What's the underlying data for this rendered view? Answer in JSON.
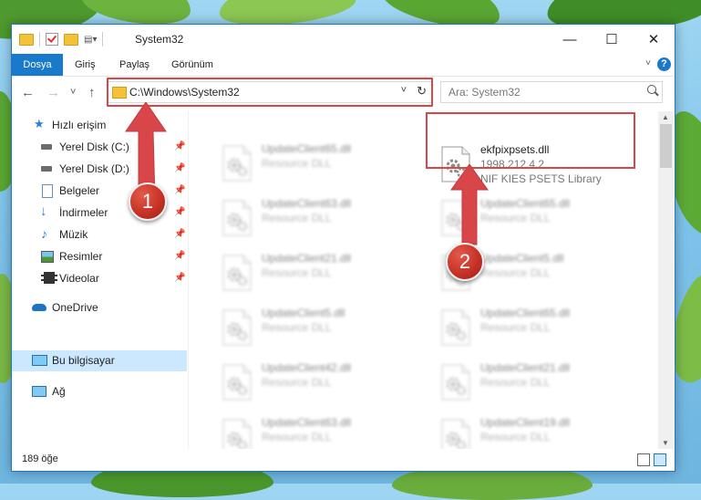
{
  "window": {
    "title": "System32",
    "controls": {
      "minimize": "—",
      "maximize": "☐",
      "close": "✕"
    }
  },
  "menu": {
    "file": "Dosya",
    "home": "Giriş",
    "share": "Paylaş",
    "view": "Görünüm",
    "help": "?"
  },
  "nav": {
    "back": "←",
    "forward": "→",
    "recent": "˅",
    "up": "↑",
    "address": "C:\\Windows\\System32",
    "search_placeholder": "Ara: System32"
  },
  "sidebar": {
    "quick_access": "Hızlı erişim",
    "items": [
      {
        "label": "Yerel Disk (C:)",
        "icon": "drive-icon"
      },
      {
        "label": "Yerel Disk (D:)",
        "icon": "drive-icon"
      },
      {
        "label": "Belgeler",
        "icon": "documents-icon"
      },
      {
        "label": "İndirmeler",
        "icon": "download-icon"
      },
      {
        "label": "Müzik",
        "icon": "music-icon"
      },
      {
        "label": "Resimler",
        "icon": "pictures-icon"
      },
      {
        "label": "Videolar",
        "icon": "video-icon"
      }
    ],
    "onedrive": "OneDrive",
    "this_pc": "Bu bilgisayar",
    "network": "Ağ"
  },
  "files": {
    "left": [
      {
        "name": "UpdateClient65.dll",
        "desc": "Resource DLL"
      },
      {
        "name": "UpdateClient63.dll",
        "desc": "Resource DLL"
      },
      {
        "name": "UpdateClient21.dll",
        "desc": "Resource DLL"
      },
      {
        "name": "UpdateClient5.dll",
        "desc": "Resource DLL"
      },
      {
        "name": "UpdateClient42.dll",
        "desc": "Resource DLL"
      },
      {
        "name": "UpdateClient63.dll",
        "desc": "Resource DLL"
      }
    ],
    "right": [
      {
        "name": "UpdateClient65.dll",
        "desc": "Resource DLL"
      },
      {
        "name": "UpdateClient5.dll",
        "desc": "Resource DLL"
      },
      {
        "name": "UpdateClient65.dll",
        "desc": "Resource DLL"
      },
      {
        "name": "UpdateClient21.dll",
        "desc": "Resource DLL"
      },
      {
        "name": "UpdateClient19.dll",
        "desc": "Resource DLL"
      }
    ],
    "highlighted": {
      "name": "ekfpixpsets.dll",
      "version": "1998.212.4.2",
      "desc": "NIF KIES PSETS Library"
    }
  },
  "status": {
    "count": "189 öğe"
  },
  "annotations": {
    "step1": "1",
    "step2": "2",
    "color": "#d94649"
  }
}
